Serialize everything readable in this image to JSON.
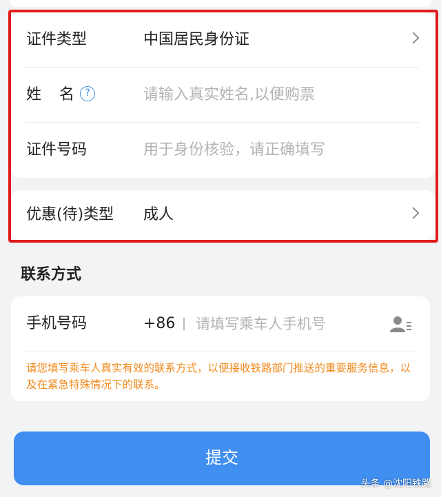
{
  "form": {
    "id_type": {
      "label": "证件类型",
      "value": "中国居民身份证"
    },
    "name": {
      "label_first": "姓",
      "label_second": "名",
      "help_glyph": "?",
      "placeholder": "请输入真实姓名,以便购票"
    },
    "id_number": {
      "label": "证件号码",
      "placeholder": "用于身份核验，请正确填写"
    },
    "discount_type": {
      "label": "优惠(待)类型",
      "value": "成人"
    }
  },
  "contact": {
    "section_title": "联系方式",
    "phone_label": "手机号码",
    "country_code": "+86",
    "phone_placeholder": "请填写乘车人手机号",
    "notice": "请您填写乘车人真实有效的联系方式，以便接收铁路部门推送的重要服务信息，以及在紧急特殊情况下的联系。"
  },
  "submit_label": "提交",
  "watermark": "头条 @沈阳铁路",
  "colors": {
    "accent": "#3f8ef0",
    "highlight_border": "#e01c1c",
    "notice": "#f08a1c"
  },
  "icons": {
    "chevron": "chevron-right-icon",
    "help": "help-icon",
    "contact": "contact-book-icon"
  }
}
